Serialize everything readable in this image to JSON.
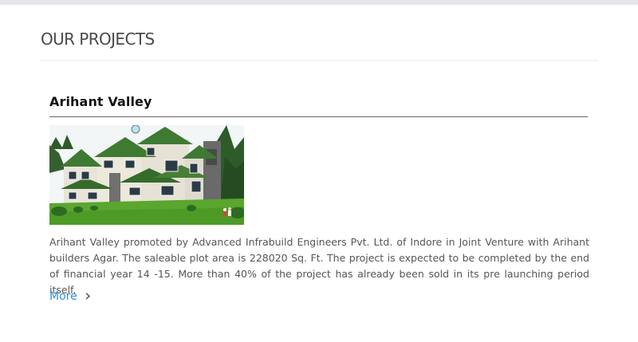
{
  "section": {
    "title": "OUR PROJECTS"
  },
  "project": {
    "title": "Arihant Valley",
    "description": "Arihant Valley promoted by Advanced Infrabuild Engineers Pvt. Ltd. of Indore in Joint Venture with Arihant builders Agar. The saleable plot area is 228020 Sq. Ft. The project is expected to be completed by the end of financial year 14 -15. More than 40% of the project has already been sold in its pre launching period itself.",
    "more_label": "More",
    "more_icon": "chevron-right-icon"
  },
  "colors": {
    "top_bar": "#e5e5ea",
    "link": "#2e8fd6",
    "roof": "#3f7a32",
    "wall": "#e8e4d8",
    "stone": "#6a6a6a",
    "grass": "#5aa62e"
  }
}
